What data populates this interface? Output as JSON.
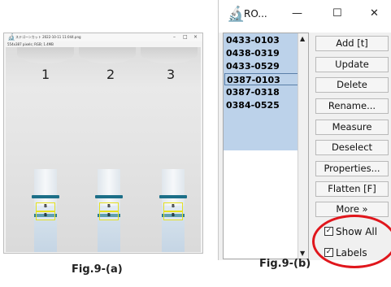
{
  "fig_a": {
    "window_icon": "imagej-microscope-icon",
    "title": "ステゴーンカット 2022-10-11 11:044.png",
    "info": "554x387 pixels; RGB; 1.4MB",
    "controls": {
      "minimize": "–",
      "maximize": "□",
      "close": "×"
    },
    "lanes": [
      {
        "number": "1",
        "roi_upper": "B",
        "roi_lower": "B"
      },
      {
        "number": "2",
        "roi_upper": "B",
        "roi_lower": "B"
      },
      {
        "number": "3",
        "roi_upper": "B",
        "roi_lower": "B"
      }
    ],
    "caption": "Fig.9-(a)"
  },
  "fig_b": {
    "window_icon": "imagej-microscope-icon",
    "title": "RO...",
    "controls": {
      "minimize": "—",
      "maximize": "☐",
      "close": "✕"
    },
    "roi_list": [
      "0433-0103",
      "0438-0319",
      "0433-0529",
      "0387-0103",
      "0387-0318",
      "0384-0525"
    ],
    "focused_index": 3,
    "buttons": [
      "Add [t]",
      "Update",
      "Delete",
      "Rename...",
      "Measure",
      "Deselect",
      "Properties...",
      "Flatten [F]",
      "More »"
    ],
    "checkboxes": [
      {
        "label": "Show All",
        "checked": true
      },
      {
        "label": "Labels",
        "checked": true
      }
    ],
    "highlight_color": "#e0161c",
    "caption": "Fig.9-(b)"
  }
}
